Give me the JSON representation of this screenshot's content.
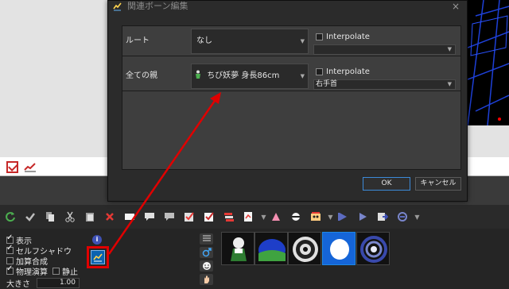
{
  "dialog": {
    "title": "関連ボーン編集",
    "close_label": "×",
    "rows": [
      {
        "label": "ルート",
        "combo": "なし",
        "interpolate_label": "Interpolate",
        "interpolate_checked": false,
        "sub_combo": ""
      },
      {
        "label": "全ての親",
        "combo": "ちび妖夢 身長86cm",
        "interpolate_label": "Interpolate",
        "interpolate_checked": false,
        "sub_combo": "右手首"
      }
    ],
    "ok_label": "OK",
    "cancel_label": "キャンセル"
  },
  "options": {
    "items": [
      {
        "label": "表示",
        "checked": true
      },
      {
        "label": "セルフシャドウ",
        "checked": true
      },
      {
        "label": "加算合成",
        "checked": false
      },
      {
        "label": "物理演算",
        "checked": true
      },
      {
        "label": "静止",
        "checked": false
      }
    ],
    "size_label": "大きさ",
    "size_value": "1.00"
  },
  "toolbar": {
    "icons": [
      "refresh-icon",
      "check-icon",
      "copy-icon",
      "cut-icon",
      "paste-icon",
      "delete-icon",
      "select-icon",
      "comment-icon",
      "comment-icon",
      "check-list-icon",
      "check-list-icon",
      "layers-icon",
      "graph-icon",
      "shape-icon",
      "shape-icon",
      "film-icon",
      "play-icon",
      "play-icon",
      "export-icon",
      "loop-icon"
    ]
  },
  "colors": {
    "annotation": "#e00000",
    "dialog_bg": "#2b2b2b",
    "panel_bg": "#3e3e3e",
    "accent": "#0b63b0"
  }
}
